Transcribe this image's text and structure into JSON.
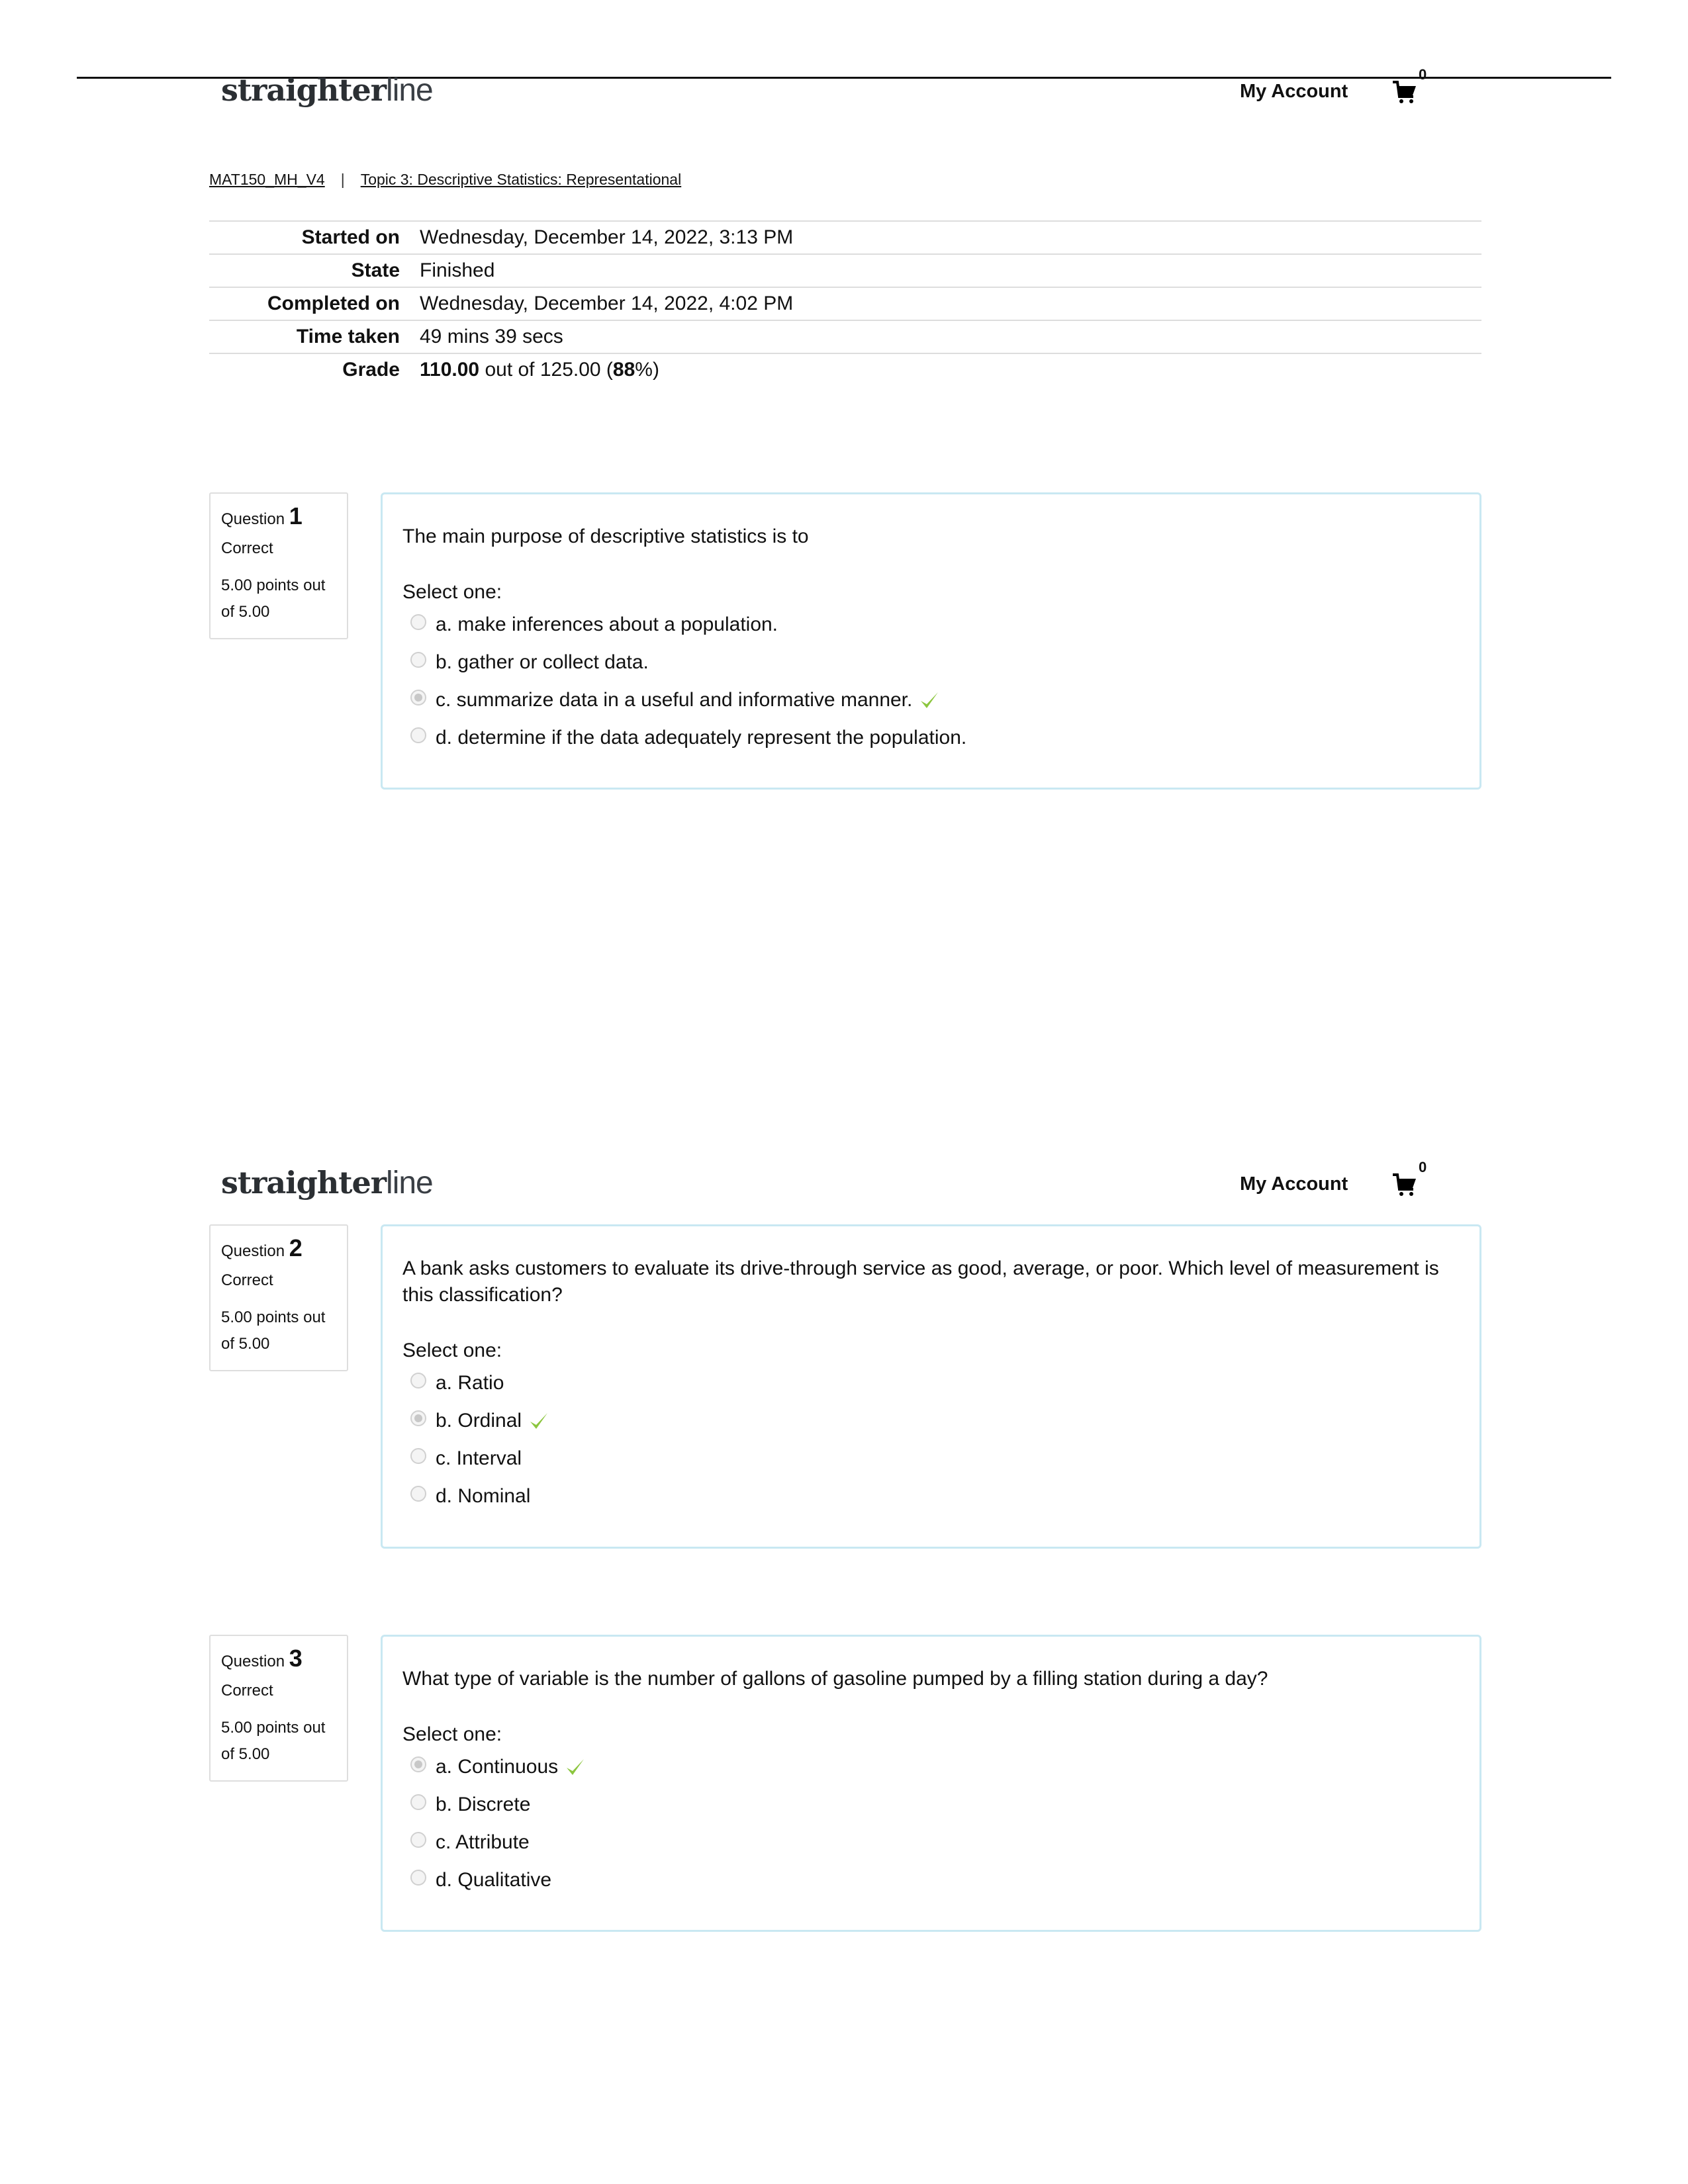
{
  "header": {
    "logo_bold": "straighter",
    "logo_light": "line",
    "account_link": "My Account",
    "cart_count": "0"
  },
  "breadcrumb": {
    "course": "MAT150_MH_V4",
    "separator": "|",
    "topic": "Topic 3: Descriptive Statistics: Representational"
  },
  "summary": {
    "rows": [
      {
        "label": "Started on",
        "value": "Wednesday, December 14, 2022, 3:13 PM"
      },
      {
        "label": "State",
        "value": "Finished"
      },
      {
        "label": "Completed on",
        "value": "Wednesday, December 14, 2022, 4:02 PM"
      },
      {
        "label": "Time taken",
        "value": "49 mins 39 secs"
      }
    ],
    "grade": {
      "label": "Grade",
      "score": "110.00",
      "out_of_text": " out of 125.00 (",
      "percent": "88",
      "suffix": "%)"
    }
  },
  "questions": [
    {
      "label": "Question",
      "number": "1",
      "state": "Correct",
      "points_line1": "5.00 points out",
      "points_line2": "of 5.00",
      "text": "The main purpose of descriptive statistics is to",
      "prompt": "Select one:",
      "options": [
        {
          "label": "a. make inferences about a population.",
          "selected": false
        },
        {
          "label": "b. gather or collect data.",
          "selected": false
        },
        {
          "label": "c. summarize data in a useful and informative manner.",
          "selected": true
        },
        {
          "label": "d. determine if the data adequately represent the population.",
          "selected": false
        }
      ]
    },
    {
      "label": "Question",
      "number": "2",
      "state": "Correct",
      "points_line1": "5.00 points out",
      "points_line2": "of 5.00",
      "text": "A bank asks customers to evaluate its drive-through service as good, average, or poor. Which level of measurement is this classification?",
      "prompt": "Select one:",
      "options": [
        {
          "label": "a. Ratio",
          "selected": false
        },
        {
          "label": "b. Ordinal",
          "selected": true
        },
        {
          "label": "c. Interval",
          "selected": false
        },
        {
          "label": "d. Nominal",
          "selected": false
        }
      ]
    },
    {
      "label": "Question",
      "number": "3",
      "state": "Correct",
      "points_line1": "5.00 points out",
      "points_line2": "of 5.00",
      "text": "What type of variable is the number of gallons of gasoline pumped by a filling station during a day?",
      "prompt": "Select one:",
      "options": [
        {
          "label": "a. Continuous",
          "selected": true
        },
        {
          "label": "b. Discrete",
          "selected": false
        },
        {
          "label": "c. Attribute",
          "selected": false
        },
        {
          "label": "d. Qualitative",
          "selected": false
        }
      ]
    }
  ],
  "icons": {
    "cart": "shopping-cart-icon",
    "correct": "checkmark-icon"
  },
  "colors": {
    "check_green": "#8cc63f",
    "question_border": "#c9e8f2",
    "info_border": "#dedede"
  }
}
